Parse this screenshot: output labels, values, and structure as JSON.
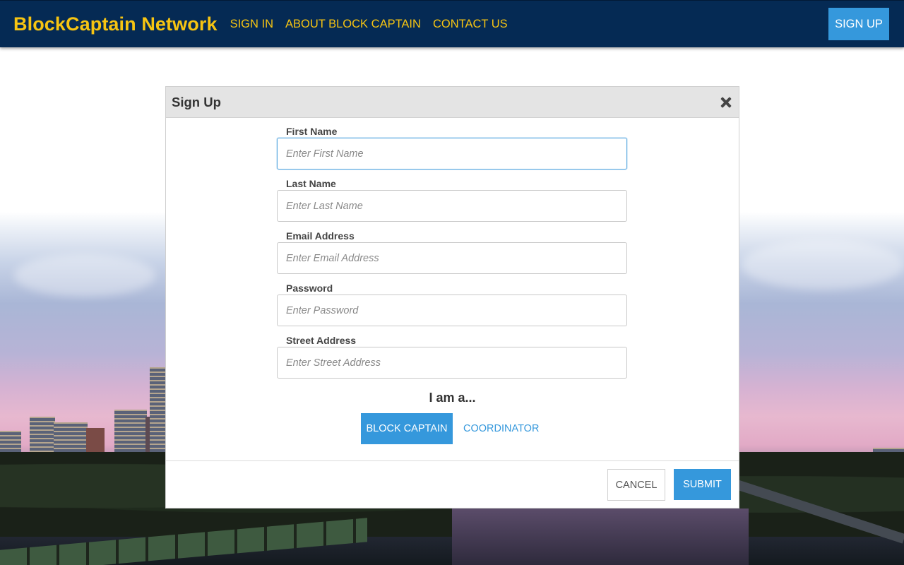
{
  "navbar": {
    "brand": "BlockCaptain Network",
    "links": [
      "SIGN IN",
      "ABOUT BLOCK CAPTAIN",
      "CONTACT US"
    ],
    "signup_label": "SIGN UP",
    "background_color": "#052a54",
    "accent_color": "#f6c412"
  },
  "modal": {
    "title": "Sign Up",
    "close_icon": "close-icon",
    "fields": [
      {
        "label": "First Name",
        "placeholder": "Enter First Name",
        "value": ""
      },
      {
        "label": "Last Name",
        "placeholder": "Enter Last Name",
        "value": ""
      },
      {
        "label": "Email Address",
        "placeholder": "Enter Email Address",
        "value": ""
      },
      {
        "label": "Password",
        "placeholder": "Enter Password",
        "value": ""
      },
      {
        "label": "Street Address",
        "placeholder": "Enter Street Address",
        "value": ""
      }
    ],
    "role_heading": "I am a...",
    "roles": {
      "selected": "BLOCK CAPTAIN",
      "other": "COORDINATOR"
    },
    "cancel_label": "CANCEL",
    "submit_label": "SUBMIT",
    "button_color": "#3598dc"
  }
}
